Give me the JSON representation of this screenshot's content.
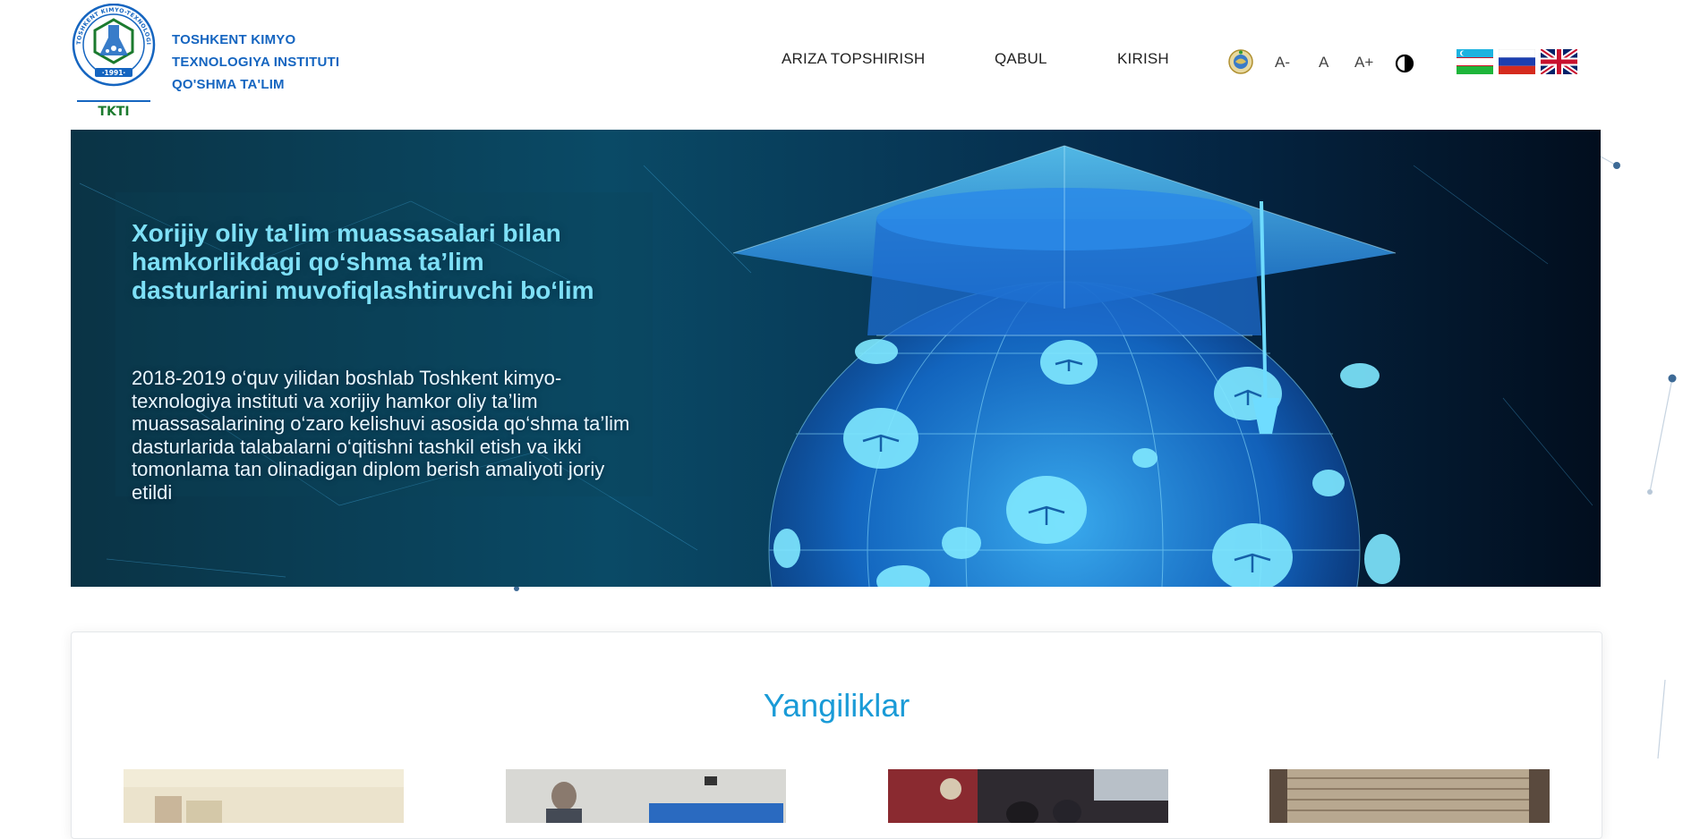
{
  "header": {
    "logo": {
      "ring_text": "TOSHKENT KIMYO-TEXNOLOGIYA INSTITUTI",
      "year": "·1991·",
      "abbr": "TKTI"
    },
    "institute_name": [
      "TOSHKENT KIMYO",
      "TEXNOLOGIYA INSTITUTI",
      "QO'SHMA TA'LIM"
    ],
    "nav": {
      "ariza": "ARIZA TOPSHIRISH",
      "qabul": "QABUL",
      "kirish": "KIRISH"
    },
    "accessibility": {
      "font_decrease": "A-",
      "font_normal": "A",
      "font_increase": "A+",
      "contrast_icon": "contrast-icon",
      "emblem_icon": "uzbekistan-emblem-icon"
    },
    "languages": [
      {
        "code": "uz",
        "icon": "flag-uzbekistan-icon"
      },
      {
        "code": "ru",
        "icon": "flag-russia-icon"
      },
      {
        "code": "en",
        "icon": "flag-uk-icon"
      }
    ]
  },
  "banner": {
    "title": "Xorijiy oliy ta'lim muassasalari bilan hamkorlikdagi qo‘shma ta’lim dasturlarini muvofiqlashtiruvchi bo‘lim",
    "text": "2018-2019 o‘quv yilidan boshlab Toshkent kimyo-texnologiya instituti va xorijiy hamkor oliy ta’lim muassasalarining o‘zaro kelishuvi asosida qo‘shma ta’lim dasturlarida talabalarni o‘qitishni tashkil etish va ikki tomonlama tan olinadigan diplom berish amaliyoti joriy etildi"
  },
  "news": {
    "title": "Yangiliklar"
  },
  "colors": {
    "brand_blue": "#1565c0",
    "logo_green": "#1b7a2e",
    "news_title": "#1a9bd7",
    "banner_dark": "#041a2c",
    "banner_glow": "#3fb8ff"
  }
}
